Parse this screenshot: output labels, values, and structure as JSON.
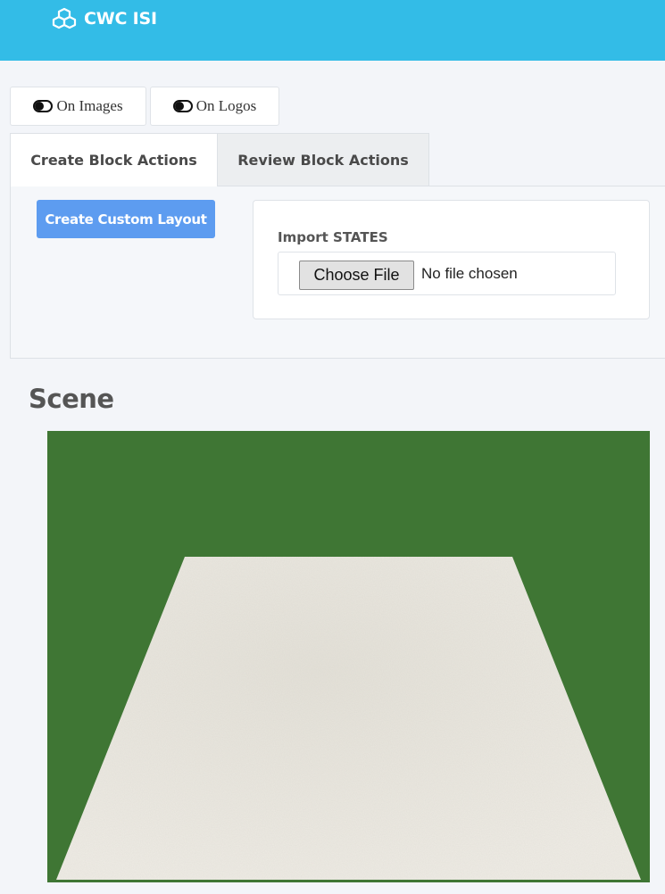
{
  "header": {
    "brand": "CWC ISI",
    "logo_icon": "cubes-icon",
    "background": "#33bce7"
  },
  "toggles": [
    {
      "label": "On Images",
      "icon": "toggle-on-icon"
    },
    {
      "label": "On Logos",
      "icon": "toggle-on-icon"
    }
  ],
  "tabs": [
    {
      "label": "Create Block Actions",
      "active": true
    },
    {
      "label": "Review Block Actions",
      "active": false
    }
  ],
  "actions": {
    "create_custom_layout": "Create Custom Layout"
  },
  "import": {
    "label": "Import STATES",
    "button": "Choose File",
    "status": "No file chosen"
  },
  "scene": {
    "title": "Scene",
    "ground_color": "#3f7634",
    "table_color": "#ece9e1"
  },
  "colors": {
    "primary": "#5d9cf0",
    "page_bg": "#f3f5f9"
  }
}
